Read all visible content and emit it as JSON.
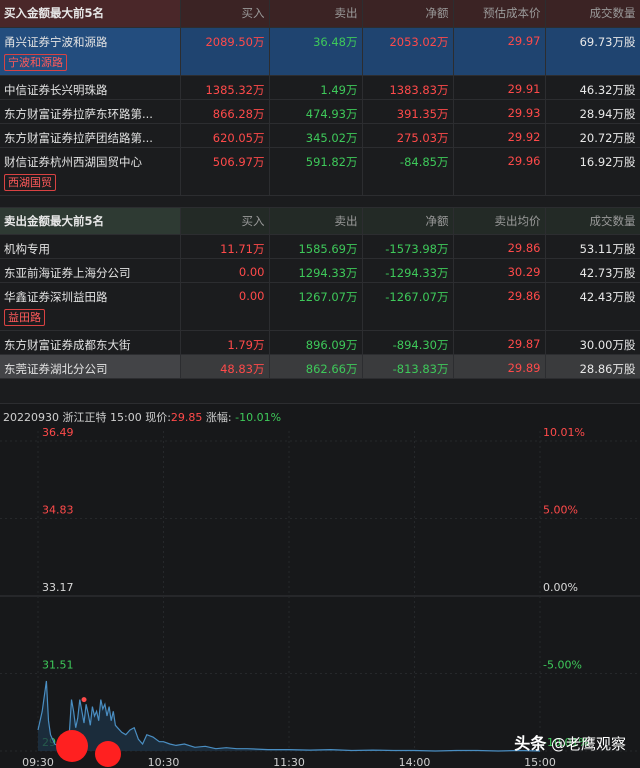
{
  "buy_section": {
    "title": "买入金额最大前5名",
    "headers": [
      "买入",
      "卖出",
      "净额",
      "预估成本价",
      "成交数量"
    ],
    "rows": [
      {
        "name": "甬兴证券宁波和源路",
        "tag": "宁波和源路",
        "buy": "2089.50万",
        "sell": "36.48万",
        "net": "2053.02万",
        "price": "29.97",
        "volume": "69.73万股"
      },
      {
        "name": "中信证券长兴明珠路",
        "tag": "",
        "buy": "1385.32万",
        "sell": "1.49万",
        "net": "1383.83万",
        "price": "29.91",
        "volume": "46.32万股"
      },
      {
        "name": "东方财富证券拉萨东环路第...",
        "tag": "",
        "buy": "866.28万",
        "sell": "474.93万",
        "net": "391.35万",
        "price": "29.93",
        "volume": "28.94万股"
      },
      {
        "name": "东方财富证券拉萨团结路第...",
        "tag": "",
        "buy": "620.05万",
        "sell": "345.02万",
        "net": "275.03万",
        "price": "29.92",
        "volume": "20.72万股"
      },
      {
        "name": "财信证券杭州西湖国贸中心",
        "tag": "西湖国贸",
        "buy": "506.97万",
        "sell": "591.82万",
        "net": "-84.85万",
        "price": "29.96",
        "volume": "16.92万股"
      }
    ]
  },
  "sell_section": {
    "title": "卖出金额最大前5名",
    "headers": [
      "买入",
      "卖出",
      "净额",
      "卖出均价",
      "成交数量"
    ],
    "rows": [
      {
        "name": "机构专用",
        "tag": "",
        "buy": "11.71万",
        "sell": "1585.69万",
        "net": "-1573.98万",
        "price": "29.86",
        "volume": "53.11万股"
      },
      {
        "name": "东亚前海证券上海分公司",
        "tag": "",
        "buy": "0.00",
        "sell": "1294.33万",
        "net": "-1294.33万",
        "price": "30.29",
        "volume": "42.73万股"
      },
      {
        "name": "华鑫证券深圳益田路",
        "tag": "益田路",
        "buy": "0.00",
        "sell": "1267.07万",
        "net": "-1267.07万",
        "price": "29.86",
        "volume": "42.43万股"
      },
      {
        "name": "东方财富证券成都东大街",
        "tag": "",
        "buy": "1.79万",
        "sell": "896.09万",
        "net": "-894.30万",
        "price": "29.87",
        "volume": "30.00万股"
      },
      {
        "name": "东莞证券湖北分公司",
        "tag": "",
        "buy": "48.83万",
        "sell": "862.66万",
        "net": "-813.83万",
        "price": "29.89",
        "volume": "28.86万股"
      }
    ]
  },
  "chart_header": {
    "date": "20220930",
    "stock": "浙江正特",
    "time": "15:00",
    "price_label": "现价:",
    "price": "29.85",
    "change_label": "涨幅:",
    "change": "-10.01%"
  },
  "watermark": {
    "prefix": "头条",
    "text": "@老鹰观察"
  },
  "colors": {
    "up": "#ff4a4a",
    "down": "#3ec95a",
    "line": "#4a8ec2"
  },
  "chart_data": {
    "type": "line",
    "title": "",
    "left_ticks": [
      "36.49",
      "34.83",
      "33.17",
      "31.51",
      "29.85"
    ],
    "right_ticks": [
      "10.01%",
      "5.00%",
      "0.00%",
      "-5.00%",
      "-10.01%"
    ],
    "x_ticks": [
      "09:30",
      "10:30",
      "11:30",
      "14:00",
      "15:00"
    ],
    "ylim": [
      29.85,
      36.49
    ],
    "prev_close": 33.17,
    "x_unit": "trading minutes since 09:30",
    "x_range": [
      0,
      240
    ],
    "series": [
      {
        "x": [
          0,
          2,
          4,
          5,
          6,
          8,
          10,
          12,
          14,
          15,
          16,
          17,
          18,
          19,
          20,
          21,
          22,
          23,
          24,
          25,
          26,
          27,
          28,
          29,
          30,
          31,
          32,
          33,
          34,
          35,
          36,
          37,
          38,
          40,
          42,
          44,
          46,
          48,
          50,
          52,
          55,
          58,
          60,
          63,
          66,
          70,
          75,
          80,
          85,
          90,
          95,
          100,
          110,
          120,
          130,
          140,
          150,
          160,
          170,
          180,
          190,
          200,
          210,
          220,
          230,
          240
        ],
        "y": [
          30.3,
          30.7,
          31.35,
          30.5,
          30.2,
          30.0,
          29.95,
          29.95,
          30.0,
          30.25,
          30.95,
          30.7,
          30.35,
          30.55,
          30.95,
          30.7,
          30.45,
          30.85,
          30.65,
          30.4,
          30.8,
          30.6,
          30.7,
          30.5,
          30.95,
          30.75,
          30.85,
          30.6,
          30.8,
          30.5,
          30.7,
          30.4,
          30.35,
          30.25,
          30.2,
          30.3,
          30.35,
          30.1,
          30.0,
          30.2,
          30.15,
          30.05,
          30.05,
          30.0,
          29.97,
          30.0,
          29.93,
          29.95,
          29.9,
          29.92,
          29.9,
          29.9,
          29.88,
          29.88,
          29.87,
          29.88,
          29.86,
          29.87,
          29.86,
          29.86,
          29.85,
          29.86,
          29.86,
          29.85,
          29.86,
          29.85
        ]
      }
    ]
  }
}
